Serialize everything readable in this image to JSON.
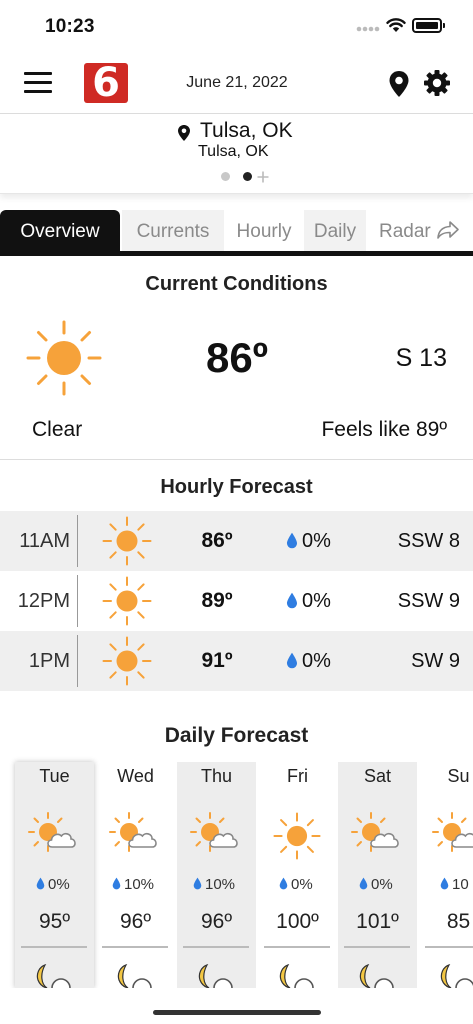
{
  "status_bar": {
    "time": "10:23"
  },
  "header": {
    "logo_text": "6",
    "date": "June 21, 2022",
    "icons": [
      "menu-icon",
      "location-pin-icon",
      "gear-icon"
    ]
  },
  "location": {
    "city": "Tulsa, OK",
    "subtitle": "Tulsa, OK",
    "page_indicator": {
      "pages": 2,
      "active": 2,
      "has_add": true
    }
  },
  "tabs": [
    {
      "label": "Overview",
      "active": true
    },
    {
      "label": "Currents"
    },
    {
      "label": "Hourly"
    },
    {
      "label": "Daily"
    },
    {
      "label": "Radar"
    }
  ],
  "current": {
    "title": "Current Conditions",
    "icon": "sun-icon",
    "temperature": "86º",
    "wind": "S 13",
    "condition": "Clear",
    "feels_like": "Feels like 89º"
  },
  "hourly": {
    "title": "Hourly Forecast",
    "rows": [
      {
        "time": "11AM",
        "icon": "sun-icon",
        "temp": "86º",
        "precip": "0%",
        "wind": "SSW 8"
      },
      {
        "time": "12PM",
        "icon": "sun-icon",
        "temp": "89º",
        "precip": "0%",
        "wind": "SSW 9"
      },
      {
        "time": "1PM",
        "icon": "sun-icon",
        "temp": "91º",
        "precip": "0%",
        "wind": "SW 9"
      }
    ]
  },
  "daily": {
    "title": "Daily Forecast",
    "days": [
      {
        "day": "Tue",
        "icon": "partly-cloudy-icon",
        "precip": "0%",
        "high": "95º"
      },
      {
        "day": "Wed",
        "icon": "partly-cloudy-icon",
        "precip": "10%",
        "high": "96º"
      },
      {
        "day": "Thu",
        "icon": "partly-cloudy-icon",
        "precip": "10%",
        "high": "96º"
      },
      {
        "day": "Fri",
        "icon": "sun-icon",
        "precip": "0%",
        "high": "100º"
      },
      {
        "day": "Sat",
        "icon": "partly-cloudy-icon",
        "precip": "0%",
        "high": "101º"
      },
      {
        "day": "Su",
        "icon": "partly-cloudy-icon",
        "precip": "10",
        "high": "85"
      }
    ]
  },
  "colors": {
    "sun": "#f6a23a",
    "drop": "#2f7de1",
    "logo": "#cf2a24",
    "moon": "#f3c744"
  }
}
